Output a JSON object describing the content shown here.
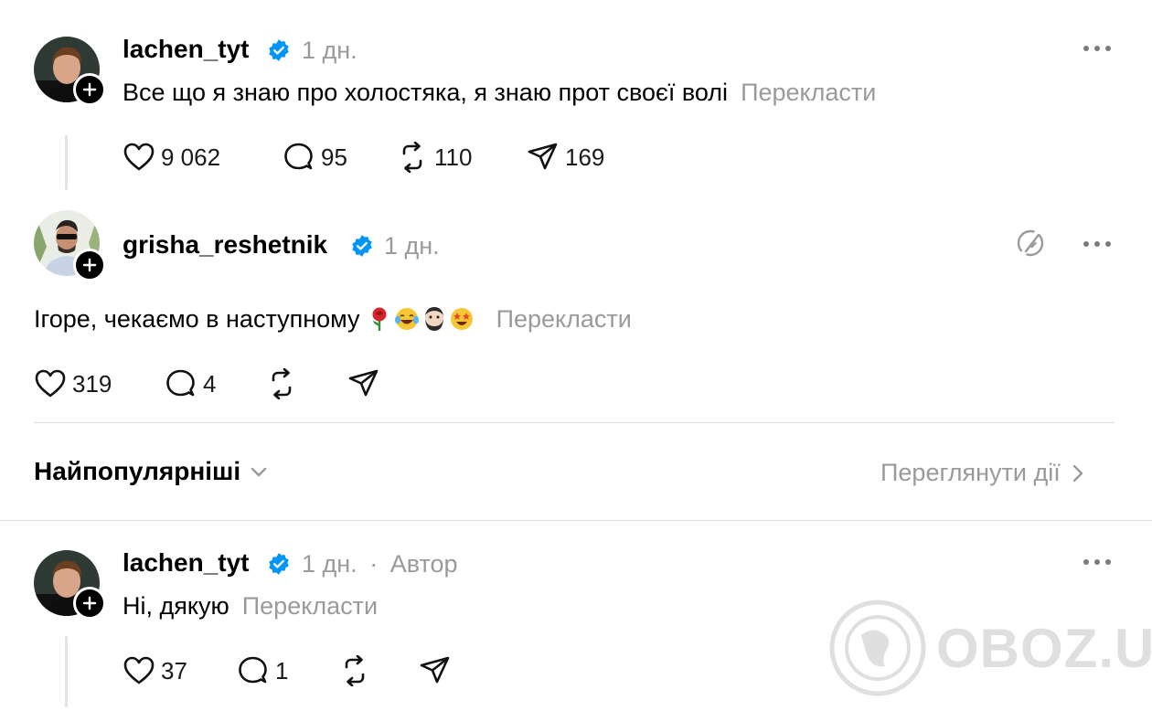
{
  "post": {
    "username": "lachen_tyt",
    "time": "1 дн.",
    "text": "Все що я знаю про холостяка, я знаю прот своєї волі",
    "translate": "Перекласти",
    "likes": "9 062",
    "comments": "95",
    "reposts": "110",
    "shares": "169"
  },
  "reply1": {
    "username": "grisha_reshetnik",
    "time": "1 дн.",
    "text": "Ігоре, чекаємо в наступному",
    "emojis": [
      "rose-emoji",
      "tears-of-joy-emoji",
      "bearded-person-emoji",
      "star-struck-emoji"
    ],
    "translate": "Перекласти",
    "likes": "319",
    "comments": "4"
  },
  "sort_bar": {
    "label": "Найпопулярніші",
    "view_activity": "Переглянути дії"
  },
  "reply2": {
    "username": "lachen_tyt",
    "time": "1 дн.",
    "separator": "·",
    "author_badge": "Автор",
    "text": "Ні, дякую",
    "translate": "Перекласти",
    "likes": "37",
    "comments": "1"
  },
  "watermark": {
    "text": "OBOZ.UA"
  },
  "colors": {
    "verified": "#0095f6",
    "muted_text": "#9a9a9a",
    "divider": "#dedede"
  }
}
